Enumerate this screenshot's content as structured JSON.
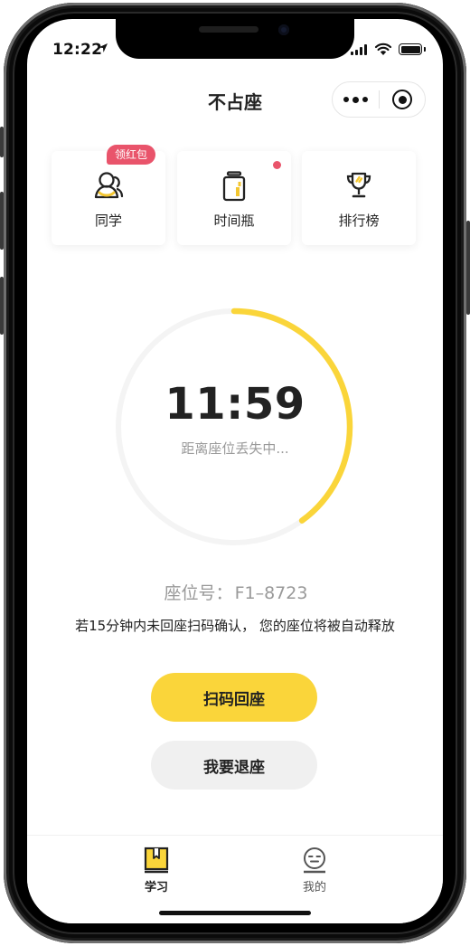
{
  "status_bar": {
    "time": "12:22"
  },
  "nav": {
    "title": "不占座"
  },
  "shortcuts": [
    {
      "label": "同学",
      "icon": "classmate-icon",
      "badge": "领红包"
    },
    {
      "label": "时间瓶",
      "icon": "time-bottle-icon",
      "has_dot": true
    },
    {
      "label": "排行榜",
      "icon": "trophy-icon"
    }
  ],
  "timer": {
    "time": "11:59",
    "subtitle": "距离座位丢失中...",
    "progress": 0.4
  },
  "seat": {
    "label": "座位号：",
    "number": "F1–8723"
  },
  "notice": "若15分钟内未回座扫码确认， 您的座位将被自动释放",
  "buttons": {
    "scan": "扫码回座",
    "leave": "我要退座"
  },
  "tabbar": [
    {
      "label": "学习",
      "icon": "book-icon",
      "active": true
    },
    {
      "label": "我的",
      "icon": "face-icon",
      "active": false
    }
  ],
  "colors": {
    "accent": "#fad53a",
    "badge": "#e9546b",
    "ring_track": "#f4f4f4",
    "secondary_button": "#f0f0f0"
  }
}
